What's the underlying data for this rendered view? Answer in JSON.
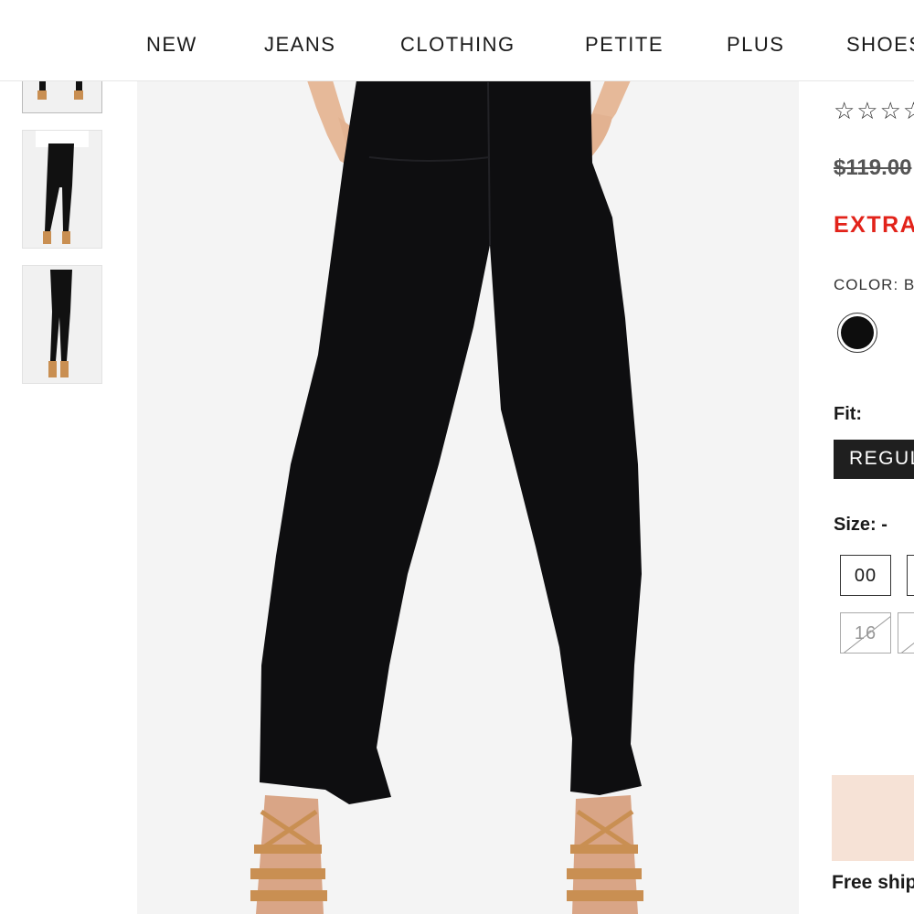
{
  "nav": {
    "items": [
      {
        "label": "NEW"
      },
      {
        "label": "JEANS"
      },
      {
        "label": "CLOTHING"
      },
      {
        "label": "PETITE"
      },
      {
        "label": "PLUS"
      },
      {
        "label": "SHOES"
      }
    ]
  },
  "gallery": {
    "thumbnails": [
      "front-full-view",
      "side-view",
      "front-full-view",
      "back-view"
    ]
  },
  "product": {
    "rating_stars": "☆☆☆☆☆",
    "original_price": "$119.00",
    "promo_text": "EXTRA",
    "color_label": "COLOR: B",
    "color_swatch_hex": "#0d0d0d",
    "fit_label": "Fit:",
    "fit_selected": "REGULAR",
    "size_label": "Size: -",
    "sizes": [
      {
        "label": "00",
        "available": true
      },
      {
        "label": "16",
        "available": false
      }
    ],
    "add_to_bag_color": "#f6e2d6",
    "shipping_text": "Free shipping"
  }
}
